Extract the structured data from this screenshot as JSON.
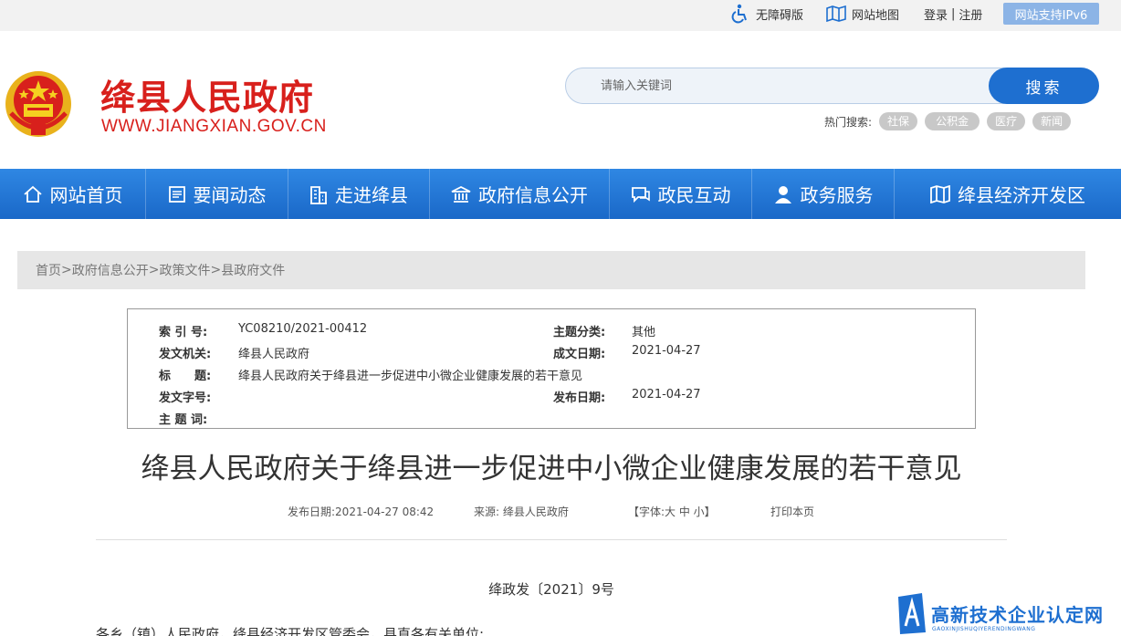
{
  "topbar": {
    "accessibility": "无障碍版",
    "sitemap": "网站地图",
    "login": "登录",
    "separator": "|",
    "register": "注册",
    "ipv6": "网站支持IPv6"
  },
  "header": {
    "title": "绛县人民政府",
    "url": "WWW.JIANGXIAN.GOV.CN",
    "emblem_icon": "national-emblem",
    "search": {
      "placeholder": "请输入关键词",
      "button": "搜索"
    },
    "hot_label": "热门搜索:",
    "hot_tags": [
      "社保",
      "公积金",
      "医疗",
      "新闻"
    ]
  },
  "nav": {
    "items": [
      {
        "label": "网站首页",
        "icon": "home-icon"
      },
      {
        "label": "要闻动态",
        "icon": "news-icon"
      },
      {
        "label": "走进绛县",
        "icon": "building-icon"
      },
      {
        "label": "政府信息公开",
        "icon": "government-icon"
      },
      {
        "label": "政民互动",
        "icon": "chat-icon"
      },
      {
        "label": "政务服务",
        "icon": "user-icon"
      },
      {
        "label": "绛县经济开发区",
        "icon": "map-icon"
      }
    ]
  },
  "breadcrumb": {
    "items": [
      "首页",
      "政府信息公开",
      "政策文件",
      "县政府文件"
    ],
    "sep_first": " > ",
    "sep": ">"
  },
  "info": {
    "index_label": "索 引 号:",
    "index_value": "YC08210/2021-00412",
    "topic_label": "主题分类:",
    "topic_value": "其他",
    "issuer_label": "发文机关:",
    "issuer_value": "绛县人民政府",
    "date_label": "成文日期:",
    "date_value": "2021-04-27",
    "title_label": "标　　题:",
    "title_value": "绛县人民政府关于绛县进一步促进中小微企业健康发展的若干意见",
    "docno_label": "发文字号:",
    "publish_label": "发布日期:",
    "publish_value": "2021-04-27",
    "keywords_label": "主 题 词:"
  },
  "article": {
    "title": "绛县人民政府关于绛县进一步促进中小微企业健康发展的若干意见",
    "meta_date": "发布日期:2021-04-27 08:42",
    "meta_source": "来源: 绛县人民政府",
    "meta_font": "【字体:大 中 小】",
    "meta_print": "打印本页",
    "doc_number": "绛政发〔2021〕9号",
    "salutation": "各乡（镇）人民政府，绛县经济开发区管委会，县直各有关单位:"
  },
  "watermark": {
    "text": "高新技术企业认定网",
    "sub": "GAOXINJISHUQIYERENDINGWANG"
  },
  "colors": {
    "brand_red": "#d8201c",
    "nav_blue": "#1e6fd0"
  }
}
